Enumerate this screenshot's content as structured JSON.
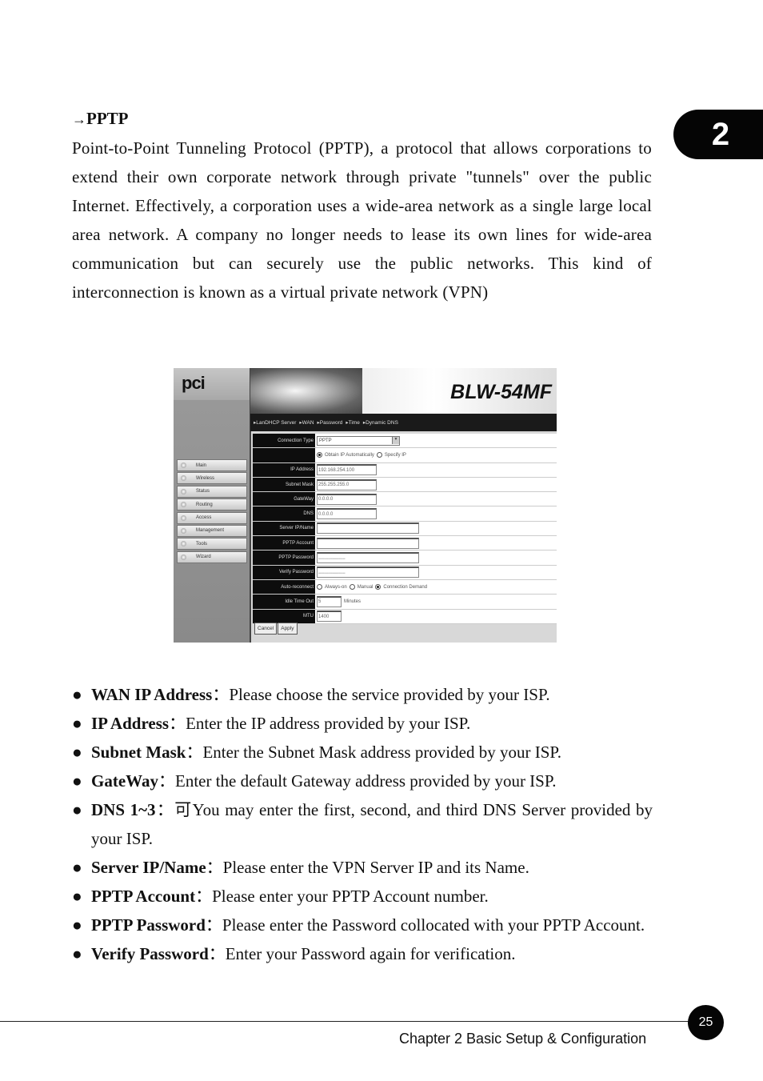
{
  "chapter_tab": "2",
  "section": {
    "arrow": "→",
    "title": "PPTP",
    "paragraph": "Point-to-Point Tunneling Protocol (PPTP), a protocol that allows corporations to extend their own corporate network through private \"tunnels\" over the public Internet. Effectively, a corporation uses a wide-area network as a single large local area network. A company no longer needs to lease its own lines for wide-area communication but can securely use the public networks. This kind of interconnection is known as a virtual private network (VPN)"
  },
  "screenshot": {
    "logo": "pci",
    "model": "BLW-54MF",
    "menu": [
      "▸LanDHCP Server",
      "▸WAN",
      "▸Password",
      "▸Time",
      "▸Dynamic DNS"
    ],
    "nav": [
      "Main",
      "Wireless",
      "Status",
      "Routing",
      "Access",
      "Management",
      "Tools",
      "Wizard"
    ],
    "form": {
      "connection_type_label": "Connection Type",
      "connection_type_value": "PPTP",
      "obtain_auto": "Obtain IP Automatically",
      "specify_ip": "Specify IP",
      "ip_label": "IP Address",
      "ip_value": "192.168.254.100",
      "mask_label": "Subnet Mask",
      "mask_value": "255.255.255.0",
      "gateway_label": "GateWay",
      "gateway_value": "0.0.0.0",
      "dns_label": "DNS",
      "dns_value": "0.0.0.0",
      "server_label": "Server IP/Name",
      "server_value": "",
      "account_label": "PPTP Account",
      "account_value": "",
      "password_label": "PPTP Password",
      "password_value": "••••••••••••••••••••••••••••••••",
      "verify_label": "Verify Password",
      "verify_value": "••••••••••••••••••••••••••••••••",
      "reconnect_label": "Auto-reconnect",
      "always_on": "Always-on",
      "manual": "Manual",
      "on_demand": "Connection Demand",
      "idle_label": "Idle Time Out",
      "idle_value": "5",
      "idle_unit": "Minutes",
      "mtu_label": "MTU",
      "mtu_value": "1400"
    },
    "buttons": {
      "cancel": "Cancel",
      "apply": "Apply"
    }
  },
  "bullets": [
    {
      "term": "WAN IP Address",
      "sep": "：",
      "desc": "Please choose the service provided by your ISP."
    },
    {
      "term": "IP Address",
      "sep": "：",
      "desc": "Enter the IP address provided by your ISP."
    },
    {
      "term": "Subnet Mask",
      "sep": "：",
      "desc": "Enter the Subnet Mask address provided by your ISP."
    },
    {
      "term": "GateWay",
      "sep": "：",
      "desc": "Enter the default Gateway address provided by your ISP."
    },
    {
      "term": "DNS 1~3",
      "sep": "：",
      "desc": "可You may enter the first, second, and third DNS Server provided by your ISP."
    },
    {
      "term": "Server IP/Name",
      "sep": "：",
      "desc": "Please enter the VPN Server IP and its Name."
    },
    {
      "term": "PPTP Account",
      "sep": "：",
      "desc": "Please enter your PPTP Account number."
    },
    {
      "term": "PPTP Password",
      "sep": "：",
      "desc": "Please enter the Password collocated with your PPTP Account."
    },
    {
      "term": "Verify Password",
      "sep": "：",
      "desc": "Enter your Password again for verification."
    }
  ],
  "footer": {
    "page_number": "25",
    "chapter_text": "Chapter 2 Basic Setup & Configuration"
  }
}
